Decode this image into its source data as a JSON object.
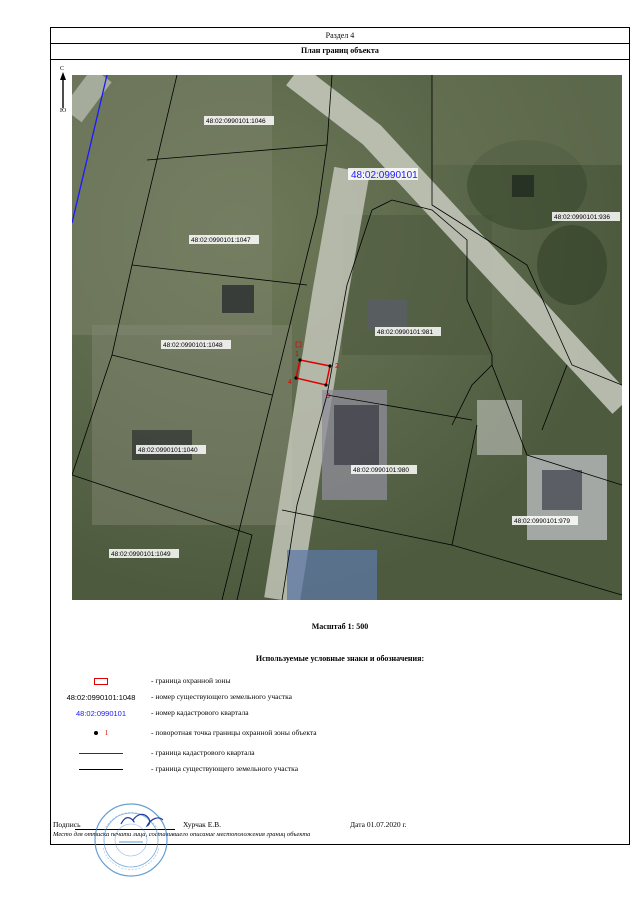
{
  "header": {
    "section": "Раздел 4",
    "title": "План границ объекта"
  },
  "compass": {
    "north": "С",
    "south": "Ю"
  },
  "map": {
    "quarter_label": "48:02:0990101",
    "parcels": [
      "48:02:0990101:1046",
      "48:02:0990101:1047",
      "48:02:0990101:1048",
      "48:02:0990101:1040",
      "48:02:0990101:1049",
      "48:02:0990101:981",
      "48:02:0990101:980",
      "48:02:0990101:979",
      "48:02:0990101:936"
    ],
    "points": [
      "1",
      "2",
      "3",
      "4"
    ]
  },
  "scale": "Масштаб 1: 500",
  "legend": {
    "title": "Используемые условные знаки и обозначения:",
    "items": {
      "zone_boundary": "- граница  охранной зоны",
      "parcel_number_example": "48:02:0990101:1048",
      "parcel_number": "- номер существующего земельного участка",
      "quarter_number_example": "48:02:0990101",
      "quarter_number": "- номер кадастрового квартала",
      "point_example": "1",
      "turn_point": "- поворотная точка границы охранной зоны объекта",
      "quarter_boundary": "- граница кадастрового квартала",
      "parcel_boundary": "- граница существующего земельного участка"
    }
  },
  "signature": {
    "label": "Подпись",
    "name": "Хурчак Е.В.",
    "date": "Дата 01.07.2020 г.",
    "place_note": "Место для оттиска печати лица, составившего описание местоположения границ объекта"
  },
  "colors": {
    "zone": "#e00000",
    "quarter_line": "#1a1aff",
    "stamp": "#3f87c9"
  }
}
